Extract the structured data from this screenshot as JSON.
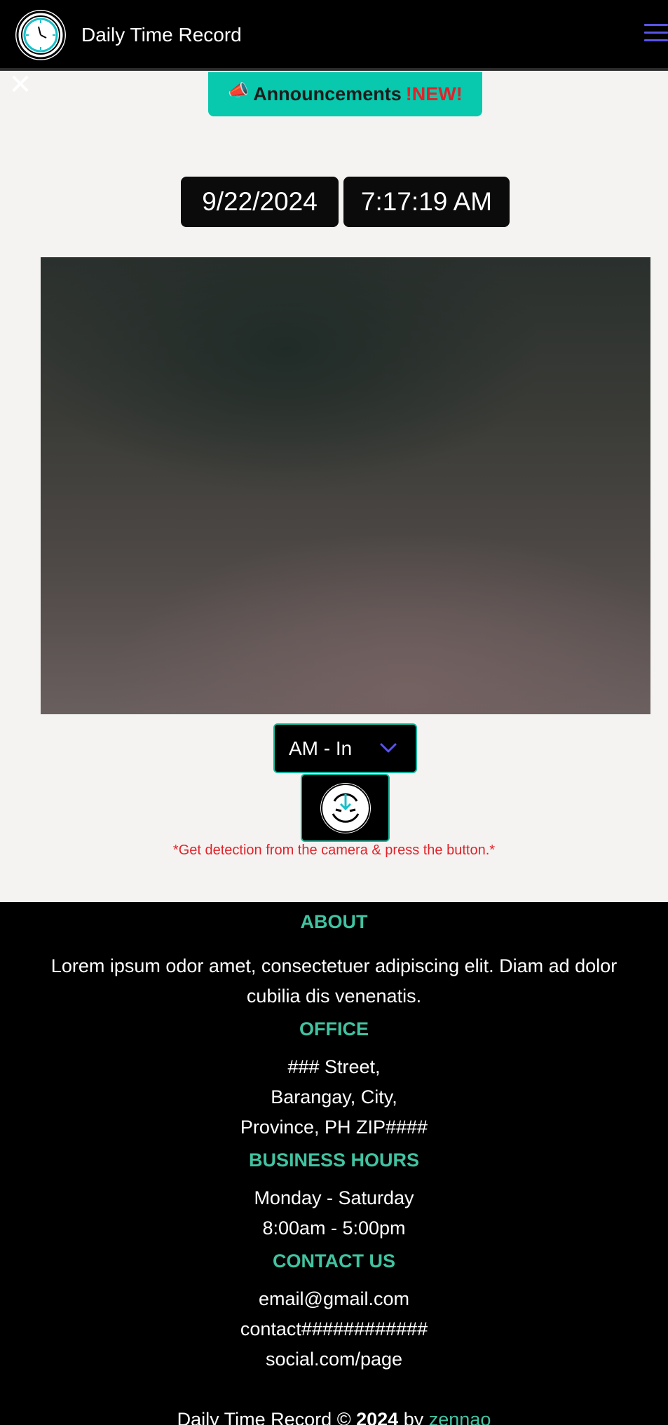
{
  "header": {
    "title": "Daily Time Record",
    "logo_icon": "clock-icon",
    "menu_icon": "hamburger-menu-icon"
  },
  "overlay": {
    "close_icon": "close-icon",
    "close_glyph": "✕"
  },
  "announcement": {
    "icon": "megaphone-icon",
    "icon_glyph": "📣",
    "label": "Announcements",
    "badge": "!NEW!"
  },
  "clock": {
    "date": "9/22/2024",
    "time": "7:17:19 AM"
  },
  "camera": {
    "label": "camera-feed"
  },
  "attendance": {
    "selected": "AM - In",
    "submit_icon": "face-scan-icon",
    "hint": "*Get detection from the camera & press the button.*"
  },
  "footer": {
    "about": {
      "heading": "ABOUT",
      "text": "Lorem ipsum odor amet, consectetuer adipiscing elit. Diam ad dolor cubilia dis venenatis."
    },
    "office": {
      "heading": "OFFICE",
      "lines": [
        "### Street,",
        "Barangay, City,",
        "Province, PH ZIP####"
      ]
    },
    "hours": {
      "heading": "BUSINESS HOURS",
      "lines": [
        "Monday - Saturday",
        "8:00am - 5:00pm"
      ]
    },
    "contact": {
      "heading": "CONTACT US",
      "lines": [
        "email@gmail.com",
        "contact############",
        "social.com/page"
      ]
    },
    "copyright": {
      "prefix": "Daily Time Record ©",
      "year": "2024",
      "by": "by",
      "author": "zennao"
    }
  },
  "colors": {
    "accent": "#08c8ad",
    "heading": "#41c3a1",
    "alert": "#e0232a",
    "menu": "#5a55e8"
  }
}
